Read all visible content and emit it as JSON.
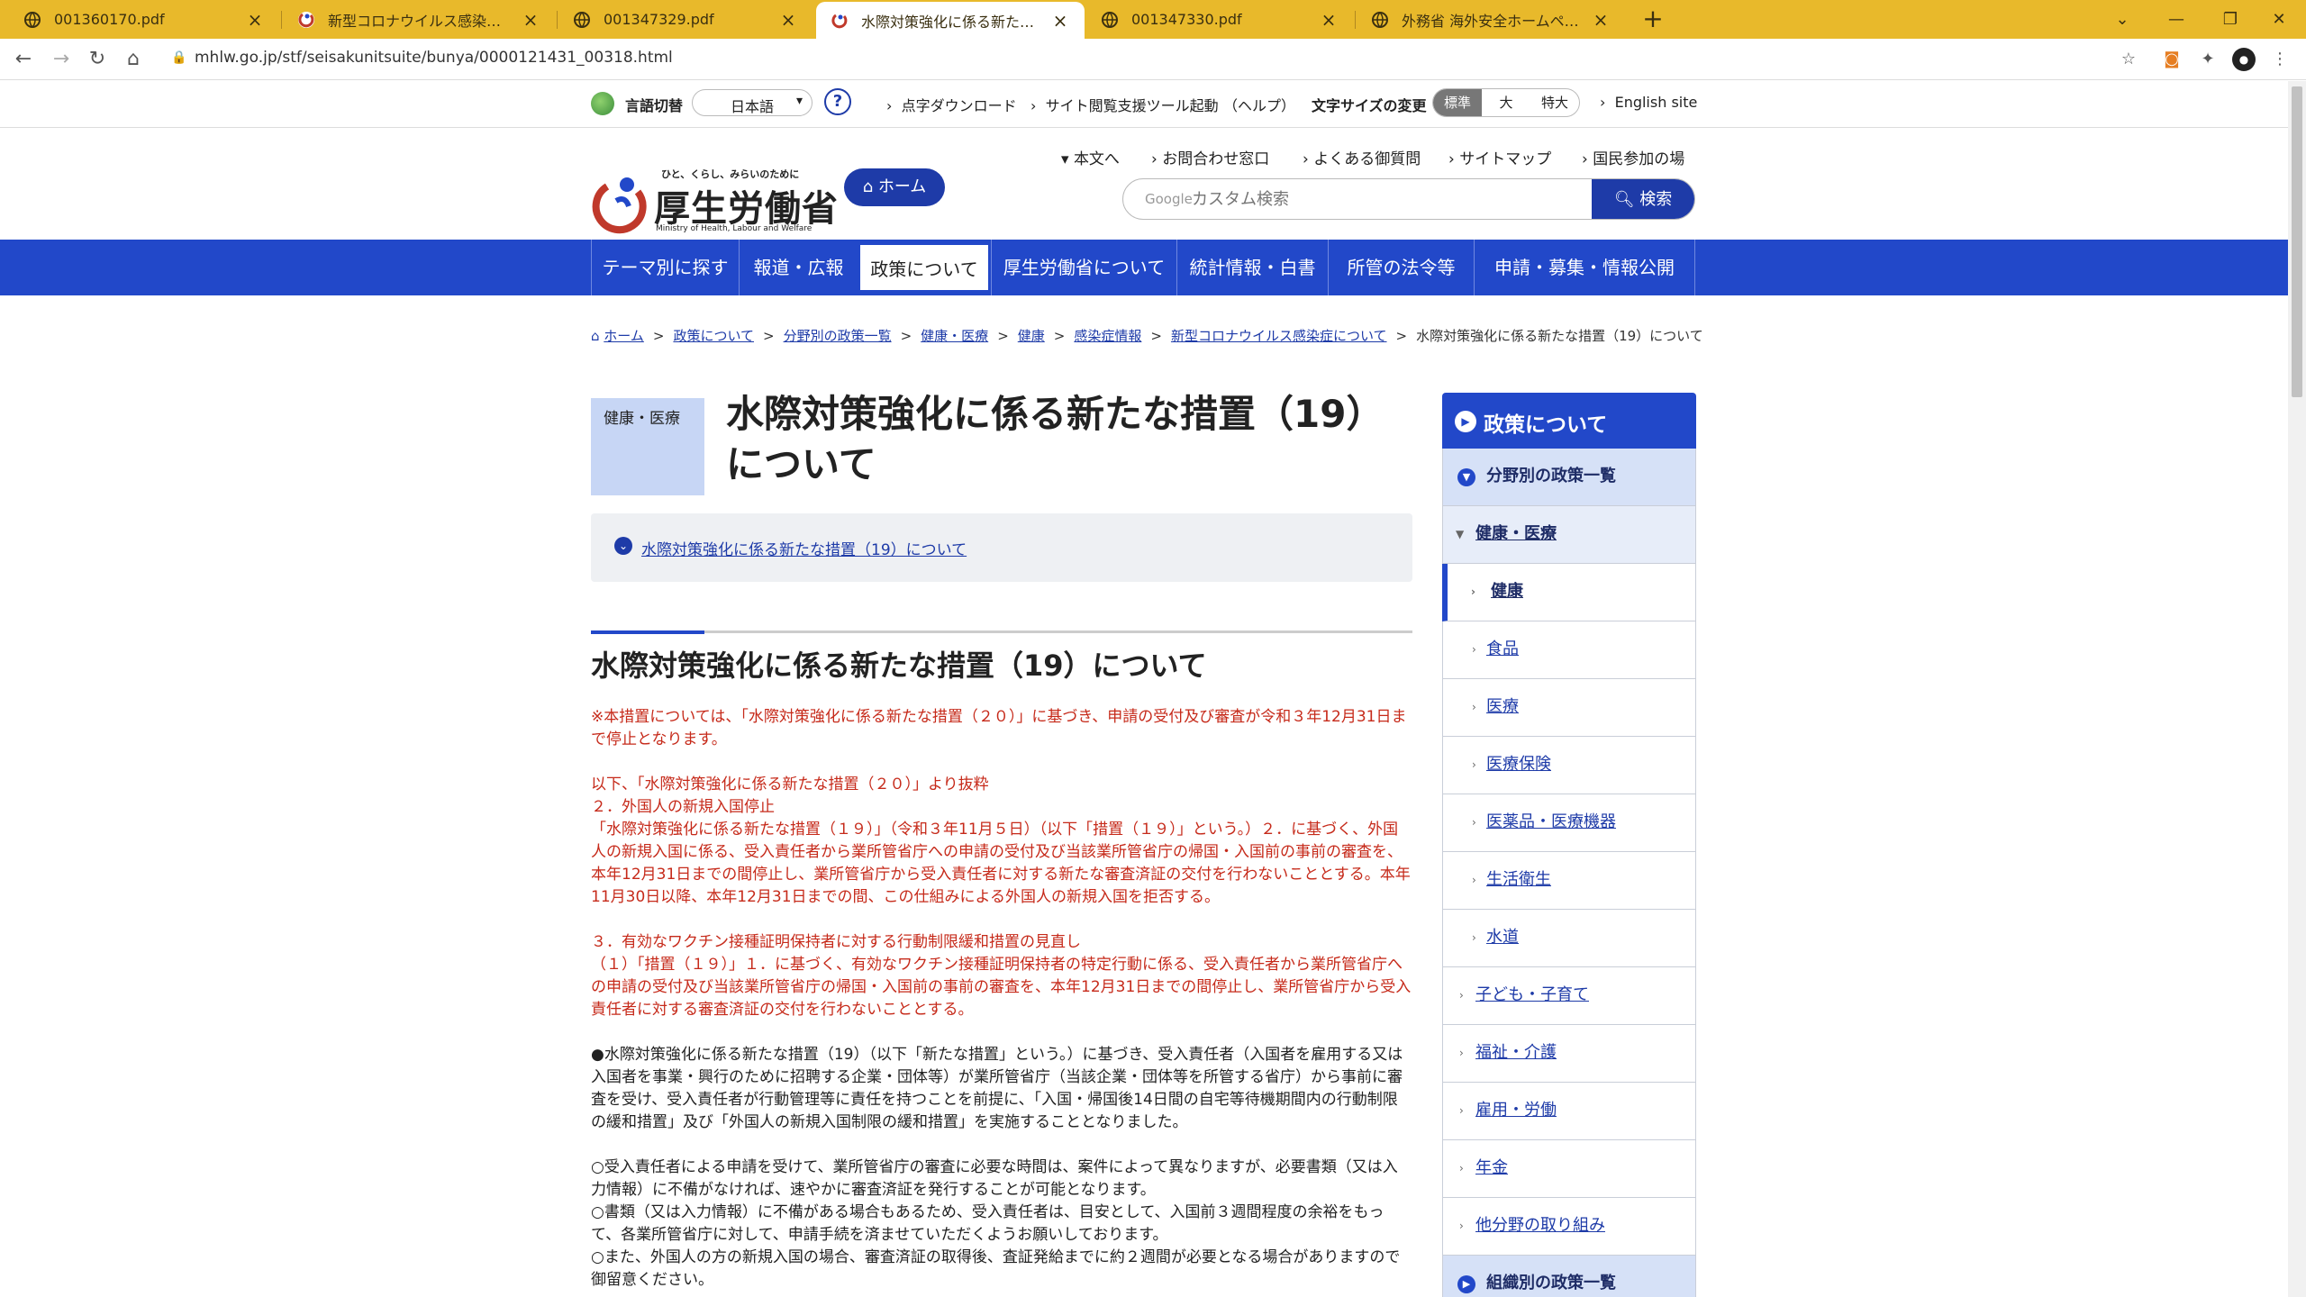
{
  "browser": {
    "tabs": [
      {
        "title": "001360170.pdf"
      },
      {
        "title": "新型コロナウイルス感染症の拡大防止"
      },
      {
        "title": "001347329.pdf"
      },
      {
        "title": "水際対策強化に係る新たな措置（"
      },
      {
        "title": "001347330.pdf"
      },
      {
        "title": "外務省 海外安全ホームページ"
      }
    ],
    "url": "mhlw.go.jp/stf/seisakunitsuite/bunya/0000121431_00318.html"
  },
  "topbar": {
    "lang_label": "言語切替",
    "lang_value": "日本語",
    "braille": "点字ダウンロード",
    "tool": "サイト閲覧支援ツール起動",
    "help": "（ヘルプ）",
    "fontsize_label": "文字サイズの変更",
    "sizes": [
      "標準",
      "大",
      "特大"
    ],
    "english": "English site"
  },
  "header": {
    "tagline": "ひと、くらし、みらいのために",
    "logo_text": "厚生労働省",
    "logo_en": "Ministry of Health, Labour and Welfare",
    "home": "ホーム",
    "util_links": [
      "本文へ",
      "お問合わせ窓口",
      "よくある御質問",
      "サイトマップ",
      "国民参加の場"
    ],
    "search_google": "Google",
    "search_placeholder": "カスタム検索",
    "search_button": "検索"
  },
  "gnav": [
    "テーマ別に探す",
    "報道・広報",
    "政策について",
    "厚生労働省について",
    "統計情報・白書",
    "所管の法令等",
    "申請・募集・情報公開"
  ],
  "breadcrumb": [
    "ホーム",
    "政策について",
    "分野別の政策一覧",
    "健康・医療",
    "健康",
    "感染症情報",
    "新型コロナウイルス感染症について",
    "水際対策強化に係る新たな措置（19）について"
  ],
  "main": {
    "category": "健康・医療",
    "title": "水際対策強化に係る新たな措置（19）について",
    "toc_link": "水際対策強化に係る新たな措置（19）について",
    "h2": "水際対策強化に係る新たな措置（19）について",
    "red_note": "※本措置については、「水際対策強化に係る新たな措置（２０）」に基づき、申請の受付及び審査が令和３年12月31日まで停止となります。",
    "red_p1": "以下、「水際対策強化に係る新たな措置（２０）」より抜粋",
    "red_p2": "２．外国人の新規入国停止",
    "red_p3": "「水際対策強化に係る新たな措置（１９）」（令和３年11月５日）（以下「措置（１９）」という。）２．に基づく、外国人の新規入国に係る、受入責任者から業所管省庁への申請の受付及び当該業所管省庁の帰国・入国前の事前の審査を、本年12月31日までの間停止し、業所管省庁から受入責任者に対する新たな審査済証の交付を行わないこととする。本年11月30日以降、本年12月31日までの間、この仕組みによる外国人の新規入国を拒否する。",
    "red_p4": "３．有効なワクチン接種証明保持者に対する行動制限緩和措置の見直し",
    "red_p5": "（１）「措置（１９）」１．に基づく、有効なワクチン接種証明保持者の特定行動に係る、受入責任者から業所管省庁への申請の受付及び当該業所管省庁の帰国・入国前の事前の審査を、本年12月31日までの間停止し、業所管省庁から受入責任者に対する審査済証の交付を行わないこととする。",
    "p1": "●水際対策強化に係る新たな措置（19）（以下「新たな措置」という。）に基づき、受入責任者（入国者を雇用する又は入国者を事業・興行のために招聘する企業・団体等）が業所管省庁（当該企業・団体等を所管する省庁）から事前に審査を受け、受入責任者が行動管理等に責任を持つことを前提に、「入国・帰国後14日間の自宅等待機期間内の行動制限の緩和措置」及び「外国人の新規入国制限の緩和措置」を実施することとなりました。",
    "p2": "○受入責任者による申請を受けて、業所管省庁の審査に必要な時間は、案件によって異なりますが、必要書類（又は入力情報）に不備がなければ、速やかに審査済証を発行することが可能となります。",
    "p3": "○書類（又は入力情報）に不備がある場合もあるため、受入責任者は、目安として、入国前３週間程度の余裕をもって、各業所管省庁に対して、申請手続を済ませていただくようお願いしております。",
    "p4": "○また、外国人の方の新規入国の場合、審査済証の取得後、査証発給までに約２週間が必要となる場合がありますので御留意ください。"
  },
  "sidenav": {
    "head": "政策について",
    "l1": "分野別の政策一覧",
    "l2": "健康・医療",
    "children": [
      "健康",
      "食品",
      "医療",
      "医療保険",
      "医薬品・医療機器",
      "生活衛生",
      "水道"
    ],
    "siblings": [
      "子ども・子育て",
      "福祉・介護",
      "雇用・労働",
      "年金",
      "他分野の取り組み"
    ],
    "l1b": "組織別の政策一覧"
  },
  "colors": {
    "chrome": "#e8b92b",
    "brand_blue": "#2248c9",
    "alert_red": "#c62a1a"
  }
}
